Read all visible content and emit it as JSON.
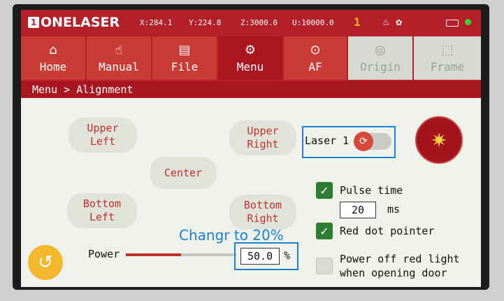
{
  "status": {
    "logo_badge": "1",
    "logo_text": "ONELASER",
    "x": "X:284.1",
    "y": "Y:224.8",
    "z": "Z:3000.0",
    "u": "U:10000.0",
    "warning_count": "1",
    "fan_icon": "fan-icon",
    "connected_color": "#3ad13a"
  },
  "tabs": [
    {
      "label": "Home",
      "icon": "⌂"
    },
    {
      "label": "Manual",
      "icon": "☝"
    },
    {
      "label": "File",
      "icon": "▤"
    },
    {
      "label": "Menu",
      "icon": "⚙"
    },
    {
      "label": "AF",
      "icon": "⊙"
    },
    {
      "label": "Origin",
      "icon": "◎"
    },
    {
      "label": "Frame",
      "icon": "⬚"
    }
  ],
  "breadcrumb": "Menu > Alignment",
  "positions": {
    "upper_left": "Upper\nLeft",
    "upper_right": "Upper\nRight",
    "center": "Center",
    "bottom_left": "Bottom\nLeft",
    "bottom_right": "Bottom\nRight"
  },
  "laser": {
    "label": "Laser 1",
    "toggle_icon": "⟳",
    "fire_icon": "✷"
  },
  "options": {
    "pulse_time_label": "Pulse time",
    "pulse_time_checked": true,
    "pulse_time_value": "20",
    "pulse_time_unit": "ms",
    "red_dot_label": "Red dot pointer",
    "red_dot_checked": true,
    "power_off_label": "Power off red light\nwhen opening door",
    "power_off_checked": false,
    "check_mark": "✓"
  },
  "power": {
    "label": "Power",
    "value": "50.0",
    "unit": "%",
    "slider_fraction": 0.5
  },
  "annotation": "Changr to 20%",
  "back_icon": "↺",
  "colors": {
    "brand_red": "#b3202a",
    "highlight_blue": "#1b7fd4",
    "check_green": "#2e7d32"
  }
}
